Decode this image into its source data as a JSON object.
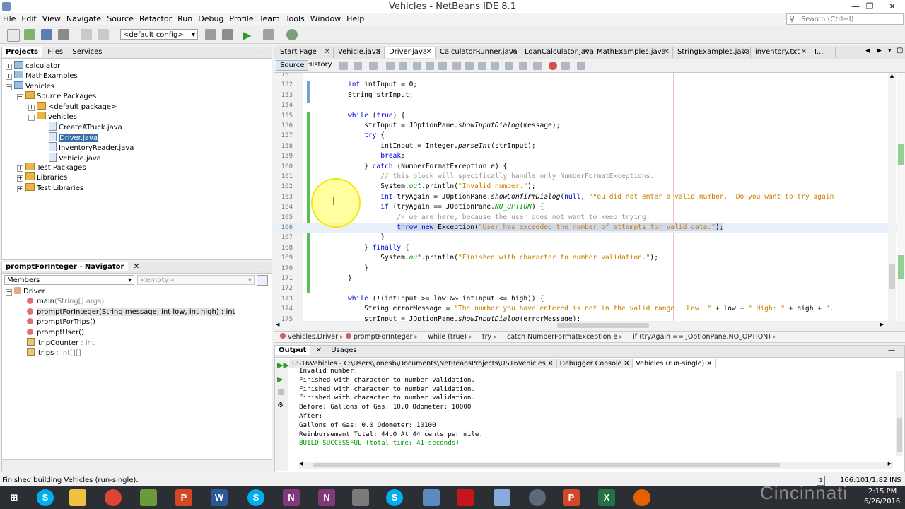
{
  "window": {
    "title": "Vehicles - NetBeans IDE 8.1",
    "min": "—",
    "max": "❐",
    "close": "✕"
  },
  "menu": [
    "File",
    "Edit",
    "View",
    "Navigate",
    "Source",
    "Refactor",
    "Run",
    "Debug",
    "Profile",
    "Team",
    "Tools",
    "Window",
    "Help"
  ],
  "search": {
    "placeholder": "Search (Ctrl+I)"
  },
  "toolbar": {
    "config": "<default config>"
  },
  "projects": {
    "tabs": [
      "Projects",
      "Files",
      "Services"
    ],
    "tree": [
      {
        "label": "calculator",
        "depth": 0,
        "type": "project",
        "exp": "+"
      },
      {
        "label": "MathExamples",
        "depth": 0,
        "type": "project",
        "exp": "+"
      },
      {
        "label": "Vehicles",
        "depth": 0,
        "type": "project",
        "exp": "−"
      },
      {
        "label": "Source Packages",
        "depth": 1,
        "type": "folder",
        "exp": "−"
      },
      {
        "label": "<default package>",
        "depth": 2,
        "type": "folder",
        "exp": "+"
      },
      {
        "label": "vehicles",
        "depth": 2,
        "type": "folder",
        "exp": "−"
      },
      {
        "label": "CreateATruck.java",
        "depth": 3,
        "type": "file"
      },
      {
        "label": "Driver.java",
        "depth": 3,
        "type": "file",
        "selected": true
      },
      {
        "label": "InventoryReader.java",
        "depth": 3,
        "type": "file"
      },
      {
        "label": "Vehicle.java",
        "depth": 3,
        "type": "file"
      },
      {
        "label": "Test Packages",
        "depth": 1,
        "type": "folder",
        "exp": "+"
      },
      {
        "label": "Libraries",
        "depth": 1,
        "type": "folder",
        "exp": "+"
      },
      {
        "label": "Test Libraries",
        "depth": 1,
        "type": "folder",
        "exp": "+"
      }
    ]
  },
  "navigator": {
    "title": "promptForInteger - Navigator",
    "filter": "Members",
    "empty": "<empty>",
    "class": "Driver",
    "items": [
      {
        "name": "main",
        "sig": "(String[] args)"
      },
      {
        "name": "promptForInteger(String message, int low, int high) : int",
        "sig": ""
      },
      {
        "name": "promptForTrips()",
        "sig": ""
      },
      {
        "name": "promptUser()",
        "sig": ""
      },
      {
        "name": "tripCounter",
        "sig": " : int"
      },
      {
        "name": "trips",
        "sig": " : int[][]"
      }
    ]
  },
  "editor": {
    "tabs": [
      "Start Page",
      "Vehicle.java",
      "Driver.java",
      "CalculatorRunner.java",
      "LoanCalculator.java",
      "MathExamples.java",
      "StringExamples.java",
      "inventory.txt",
      "I..."
    ],
    "active_tab": 2,
    "source_tab": "Source",
    "history_tab": "History"
  },
  "code": [
    {
      "n": "151",
      "html": ""
    },
    {
      "n": "152",
      "html": "<span class='kw'>int</span> intInput = 0;"
    },
    {
      "n": "153",
      "html": "String strInput;"
    },
    {
      "n": "154",
      "html": ""
    },
    {
      "n": "155",
      "html": "<span class='kw'>while</span> (<span class='kw'>true</span>) {"
    },
    {
      "n": "156",
      "html": "    strInput = JOptionPane.<span class='itc'>showInputDialog</span>(message);"
    },
    {
      "n": "157",
      "html": "    <span class='kw'>try</span> {"
    },
    {
      "n": "158",
      "html": "        intInput = Integer.<span class='itc'>parseInt</span>(strInput);"
    },
    {
      "n": "159",
      "html": "        <span class='kw'>break</span>;"
    },
    {
      "n": "160",
      "html": "    } <span class='kw'>catch</span> (NumberFormatException e) {"
    },
    {
      "n": "161",
      "html": "        <span class='cmt'>// this block will specifically handle only NumberFormatExceptions.</span>"
    },
    {
      "n": "162",
      "html": "        System.<span class='fld itc'>out</span>.println(<span class='str'>\"Invalid number.\"</span>);"
    },
    {
      "n": "163",
      "html": "        <span class='kw'>int</span> tryAgain = JOptionPane.<span class='itc'>showConfirmDialog</span>(<span class='kw'>null</span>, <span class='str'>\"You did not enter a valid number.  Do you want to try again</span>"
    },
    {
      "n": "164",
      "html": "        <span class='kw'>if</span> (tryAgain == JOptionPane.<span class='fld itc'>NO_OPTION</span>) {"
    },
    {
      "n": "165",
      "html": "            <span class='cmt'>// we are here, because the user does not want to keep trying.</span>"
    },
    {
      "n": "166",
      "html": "            <span class='sel'><span class='kw'>throw new</span> Exception(<span class='str'>\"User has exceeded the number of attempts for valid data.\"</span>);</span>",
      "highlight": true
    },
    {
      "n": "167",
      "html": "        }"
    },
    {
      "n": "168",
      "html": "    } <span class='kw'>finally</span> {"
    },
    {
      "n": "169",
      "html": "        System.<span class='fld itc'>out</span>.println(<span class='str'>\"Finished with character to number validation.\"</span>);"
    },
    {
      "n": "170",
      "html": "    }"
    },
    {
      "n": "171",
      "html": "}"
    },
    {
      "n": "172",
      "html": ""
    },
    {
      "n": "173",
      "html": "<span class='kw'>while</span> (!(intInput >= low && intInput <= high)) {"
    },
    {
      "n": "174",
      "html": "    String errorMessage = <span class='str'>\"The number you have entered is not in the valid range.  Low: \"</span> + low + <span class='str'>\" High: \"</span> + high + <span class='str'>\".</span>"
    },
    {
      "n": "175",
      "html": "    strInput = JOptionPane.<span class='itc'>showInputDialog</span>(errorMessage);"
    }
  ],
  "breadcrumbs": [
    "vehicles.Driver",
    "promptForInteger",
    "while (true)",
    "try",
    "catch NumberFormatException e",
    "if (tryAgain == JOptionPane.NO_OPTION)"
  ],
  "output": {
    "tabs": [
      "Output",
      "Usages"
    ],
    "subtabs": [
      "US16Vehicles - C:\\Users\\jonesb\\Documents\\NetBeansProjects\\US16Vehicles",
      "Debugger Console",
      "Vehicles (run-single)"
    ],
    "lines": [
      {
        "t": "Invalid number.",
        "c": "#000"
      },
      {
        "t": "Finished with character to number validation.",
        "c": "#000"
      },
      {
        "t": "Finished with character to number validation.",
        "c": "#000"
      },
      {
        "t": "Finished with character to number validation.",
        "c": "#000"
      },
      {
        "t": "Before: Gallons of Gas: 10.0 Odometer: 10000",
        "c": "#000"
      },
      {
        "t": "After:",
        "c": "#000"
      },
      {
        "t": "Gallons of Gas: 0.0 Odometer: 10100",
        "c": "#000"
      },
      {
        "t": "Reimbursement Total: 44.0 At 44 cents per mile.",
        "c": "#000"
      },
      {
        "t": "BUILD SUCCESSFUL (total time: 41 seconds)",
        "c": "#009900"
      }
    ]
  },
  "status": {
    "message": "Finished building Vehicles (run-single).",
    "position": "166:101/1:82",
    "mode": "INS"
  },
  "clock": {
    "time": "2:15 PM",
    "date": "6/26/2016"
  },
  "watermark": "Cincinnati",
  "colors": {
    "accent": "#2b579a",
    "selection": "#cfd9ec",
    "highlight_ring": "#f3ea3c"
  }
}
